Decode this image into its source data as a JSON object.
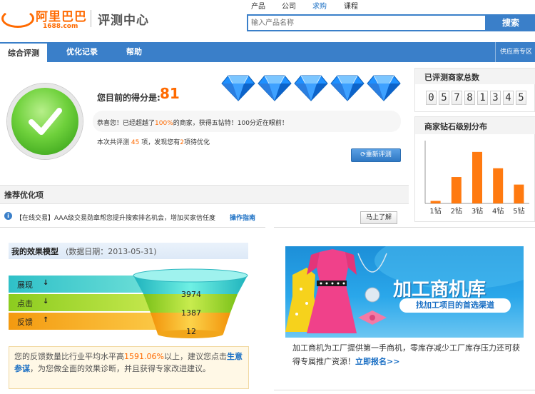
{
  "header": {
    "logo_cn": "阿里巴巴",
    "logo_sub": "1688.com",
    "site_title": "评测中心",
    "top_nav": [
      "产品",
      "公司",
      "求购",
      "课程"
    ],
    "top_nav_active": "求购",
    "search_placeholder": "输入产品名称",
    "search_button": "搜索"
  },
  "nav": {
    "tabs": [
      "综合评测",
      "优化记录",
      "帮助"
    ],
    "active_tab": "综合评测",
    "right_link": "供应商专区"
  },
  "score": {
    "label": "您目前的得分是:",
    "value": "81",
    "diamond_count": 5,
    "congrats_prefix": "恭喜您！已经超越了",
    "congrats_pct": "100%",
    "congrats_suffix": "的商家，获得五钻特！100分近在眼前！",
    "eval_prefix": "本次共评测",
    "eval_count": "45",
    "eval_mid": "项，发现您有",
    "eval_issues": "2",
    "eval_suffix": "项待优化",
    "reeval_button": "重新评测"
  },
  "recommend": {
    "title": "推荐优化项",
    "item_text": "【在线交易】AAA级交易勋章帮您提升搜索排名机会，增加买家信任度",
    "item_link": "操作指南",
    "learn_button": "马上了解"
  },
  "effect_model": {
    "title": "我的效果模型",
    "date": "(数据日期：2013-05-31)",
    "bands": [
      {
        "label": "展现",
        "arrow": "down",
        "value": "3974"
      },
      {
        "label": "点击",
        "arrow": "down",
        "value": "1387"
      },
      {
        "label": "反馈",
        "arrow": "up",
        "value": "12"
      }
    ],
    "feedback_prefix": "您的反馈数量比行业平均水平高",
    "feedback_pct": "1591.06%",
    "feedback_mid": "以上，建议您点击",
    "feedback_link": "生意参谋",
    "feedback_suffix": "，为您做全面的效果诊断，并且获得专家改进建议。"
  },
  "ad": {
    "title": "加工商机库",
    "subtitle": "找加工项目的首选渠道",
    "desc": "加工商机为工厂提供第一手商机，零库存减少工厂库存压力还可获得专属推广资源！",
    "link": "立即报名>>"
  },
  "merchant_count": {
    "title": "已评测商家总数",
    "digits": [
      "0",
      "5",
      "7",
      "8",
      "1",
      "3",
      "4",
      "5"
    ]
  },
  "diamond_dist": {
    "title": "商家钻石级别分布"
  },
  "chart_data": {
    "type": "bar",
    "title": "商家钻石级别分布",
    "categories": [
      "1钻",
      "2钻",
      "3钻",
      "4钻",
      "5钻"
    ],
    "values": [
      4,
      42,
      82,
      56,
      30
    ],
    "ylim": [
      0,
      100
    ],
    "bar_color": "#ff7a10",
    "grid": false
  },
  "colors": {
    "brand": "#ff6a00",
    "nav_blue": "#3a7fc9",
    "diamond_blue": "#1e90ff"
  }
}
